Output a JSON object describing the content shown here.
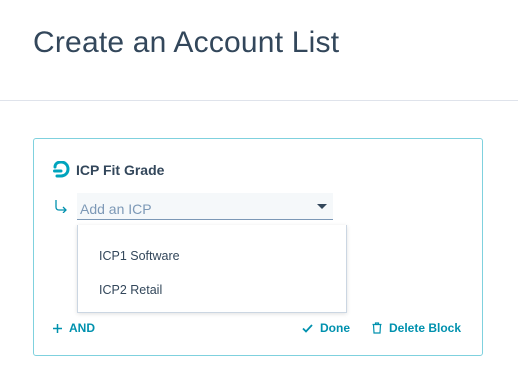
{
  "page": {
    "title": "Create an Account List"
  },
  "block": {
    "title": "ICP Fit Grade",
    "header_icon": "hubspot-sprocket-icon",
    "branch_icon": "arrow-turn-right-icon",
    "select": {
      "placeholder": "Add an ICP",
      "caret_icon": "caret-down-icon",
      "options": [
        "ICP1 Software",
        "ICP2 Retail"
      ]
    },
    "actions": {
      "and_label": "AND",
      "and_icon": "plus-icon",
      "done_label": "Done",
      "done_icon": "check-icon",
      "delete_label": "Delete Block",
      "delete_icon": "trash-icon"
    }
  },
  "colors": {
    "accent": "#0091ae",
    "border": "#7fd1de",
    "text": "#33475b",
    "muted": "#7c98b6",
    "logo": "#00a4bd"
  }
}
